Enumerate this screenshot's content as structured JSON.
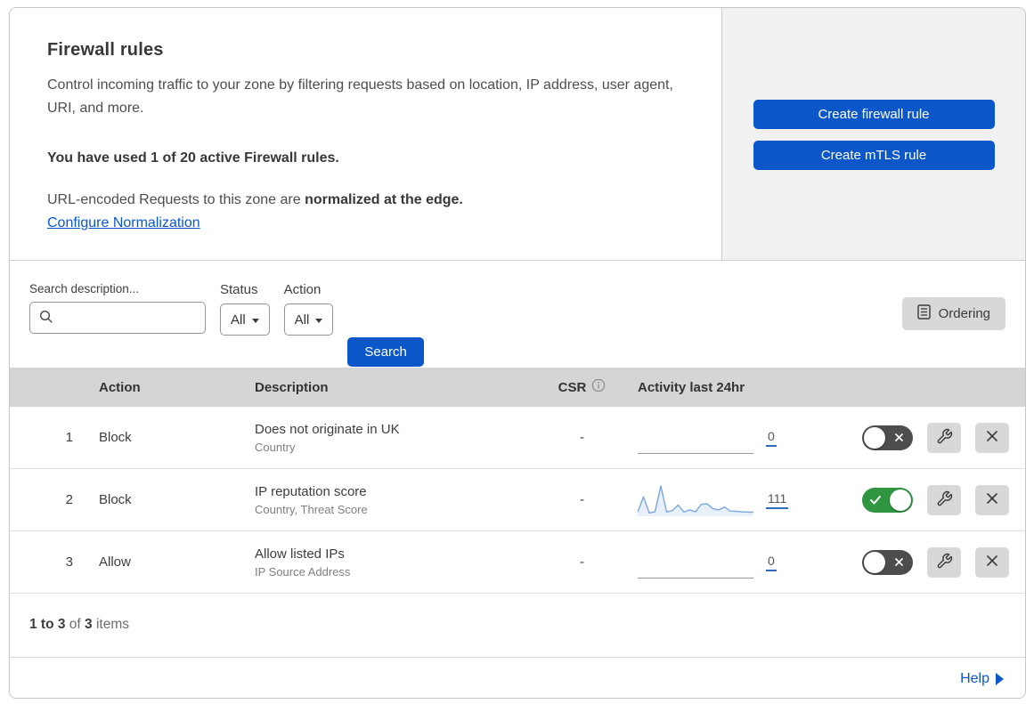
{
  "header": {
    "title": "Firewall rules",
    "description": "Control incoming traffic to your zone by filtering requests based on location, IP address, user agent, URI, and more.",
    "usage": "You have used 1 of 20 active Firewall rules.",
    "normalization_prefix": "URL-encoded Requests to this zone are ",
    "normalization_bold": "normalized at the edge.",
    "normalization_link": "Configure Normalization",
    "create_firewall_button": "Create firewall rule",
    "create_mtls_button": "Create mTLS rule"
  },
  "filters": {
    "search_label": "Search description...",
    "search_value": "",
    "status_label": "Status",
    "status_value": "All",
    "action_label": "Action",
    "action_value": "All",
    "search_button": "Search",
    "ordering_button": "Ordering"
  },
  "table": {
    "columns": {
      "action": "Action",
      "description": "Description",
      "csr": "CSR",
      "activity": "Activity last 24hr"
    },
    "rows": [
      {
        "index": "1",
        "action": "Block",
        "description": "Does not originate in UK",
        "criteria": "Country",
        "csr": "-",
        "activity_count": "0",
        "enabled": false
      },
      {
        "index": "2",
        "action": "Block",
        "description": "IP reputation score",
        "criteria": "Country, Threat Score",
        "csr": "-",
        "activity_count": "111",
        "enabled": true
      },
      {
        "index": "3",
        "action": "Allow",
        "description": "Allow listed IPs",
        "criteria": "IP Source Address",
        "csr": "-",
        "activity_count": "0",
        "enabled": false
      }
    ]
  },
  "footer": {
    "range": "1 to 3",
    "of_word": "of",
    "total": "3",
    "items_word": "items",
    "help_label": "Help"
  },
  "colors": {
    "primary_blue": "#0b57c9",
    "toggle_green": "#2f9541",
    "toggle_off_gray": "#4d4d4d",
    "panel_gray": "#f1f1f1",
    "table_header_gray": "#d5d5d5",
    "button_gray": "#d8d8d8",
    "sparkline_blue": "#7aa7e0"
  },
  "chart_data": {
    "type": "line",
    "title": "Activity last 24hr sparkline (rule 2: IP reputation score)",
    "x": [
      0,
      1,
      2,
      3,
      4,
      5,
      6,
      7,
      8,
      9,
      10,
      11,
      12,
      13,
      14,
      15,
      16,
      17,
      18,
      19,
      20
    ],
    "values": [
      8,
      62,
      5,
      10,
      100,
      8,
      14,
      33,
      8,
      16,
      9,
      36,
      37,
      20,
      16,
      26,
      12,
      11,
      9,
      8,
      8
    ],
    "ylim": [
      0,
      100
    ],
    "line_color": "#7aa7e0",
    "fill_color": "#e9f0fa",
    "total_label": "111"
  }
}
